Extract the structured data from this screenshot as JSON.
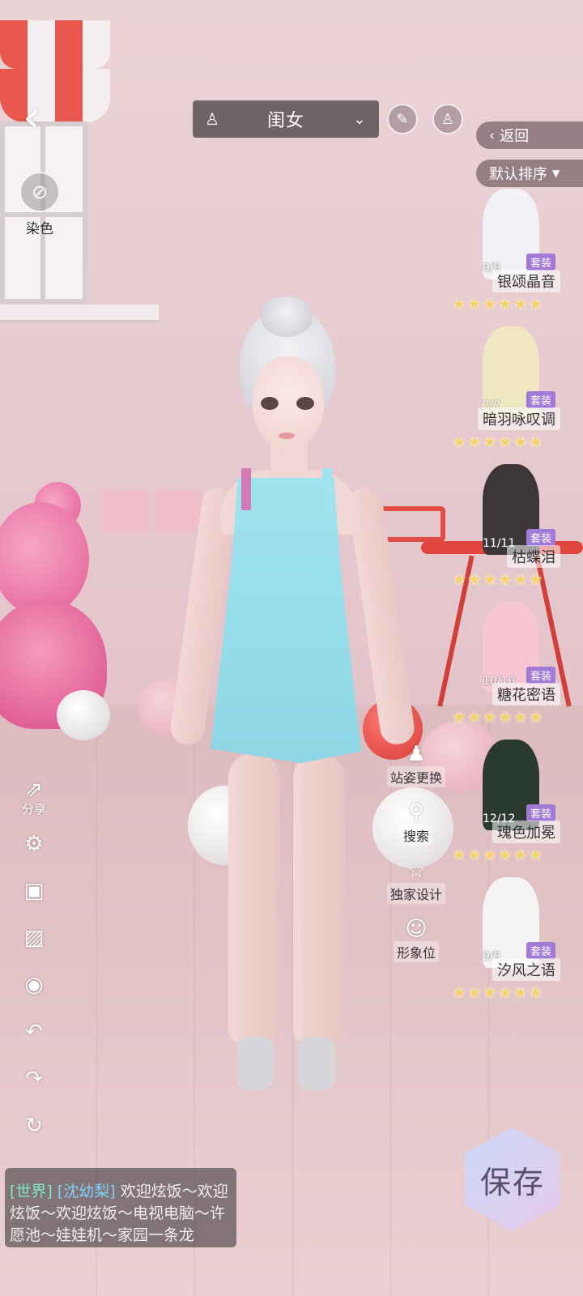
{
  "header": {
    "category_label": "闺女",
    "category_icon": "dress-outline-icon",
    "back_label": "返回",
    "sort_label": "默认排序"
  },
  "left_panel": {
    "dye_label": "染色"
  },
  "left_tools": [
    {
      "name": "share",
      "icon": "share-icon",
      "label": "分享"
    },
    {
      "name": "settings",
      "icon": "gear-icon",
      "label": ""
    },
    {
      "name": "camera",
      "icon": "camera-icon",
      "label": ""
    },
    {
      "name": "gallery",
      "icon": "image-icon",
      "label": ""
    },
    {
      "name": "visibility",
      "icon": "eye-icon",
      "label": ""
    },
    {
      "name": "undo",
      "icon": "undo-icon",
      "label": ""
    },
    {
      "name": "redo",
      "icon": "redo-icon",
      "label": ""
    },
    {
      "name": "reset",
      "icon": "reset-icon",
      "label": ""
    }
  ],
  "mid_tools": {
    "pose": "站姿更换",
    "search": "搜索",
    "exclusive": "独家设计",
    "image_slot": "形象位"
  },
  "outfits": [
    {
      "count": "9/9",
      "badge": "套装",
      "name": "银颂晶音",
      "stars": "★★★★★★",
      "color": "#f2f2f6"
    },
    {
      "count": "7/7",
      "badge": "套装",
      "name": "暗羽咏叹调",
      "stars": "★★★★★★",
      "color": "#efe7c2"
    },
    {
      "count": "11/11",
      "badge": "套装",
      "name": "枯蝶泪",
      "stars": "★★★★★★",
      "color": "#3d3638"
    },
    {
      "count": "10/10",
      "badge": "套装",
      "name": "糖花密语",
      "stars": "★★★★★★",
      "color": "#f7c6d3"
    },
    {
      "count": "12/12",
      "badge": "套装",
      "name": "瑰色加冕",
      "stars": "★★★★★★",
      "color": "#2b3a30"
    },
    {
      "count": "9/9",
      "badge": "套装",
      "name": "汐风之语",
      "stars": "★★★★★★",
      "color": "#f5f3f4"
    }
  ],
  "save_label": "保存",
  "chat": {
    "channel": "[世界]",
    "user": "[沈幼梨]",
    "message": "欢迎炫饭～欢迎炫饭～欢迎炫饭～电视电脑～许愿池～娃娃机～家园一条龙"
  }
}
